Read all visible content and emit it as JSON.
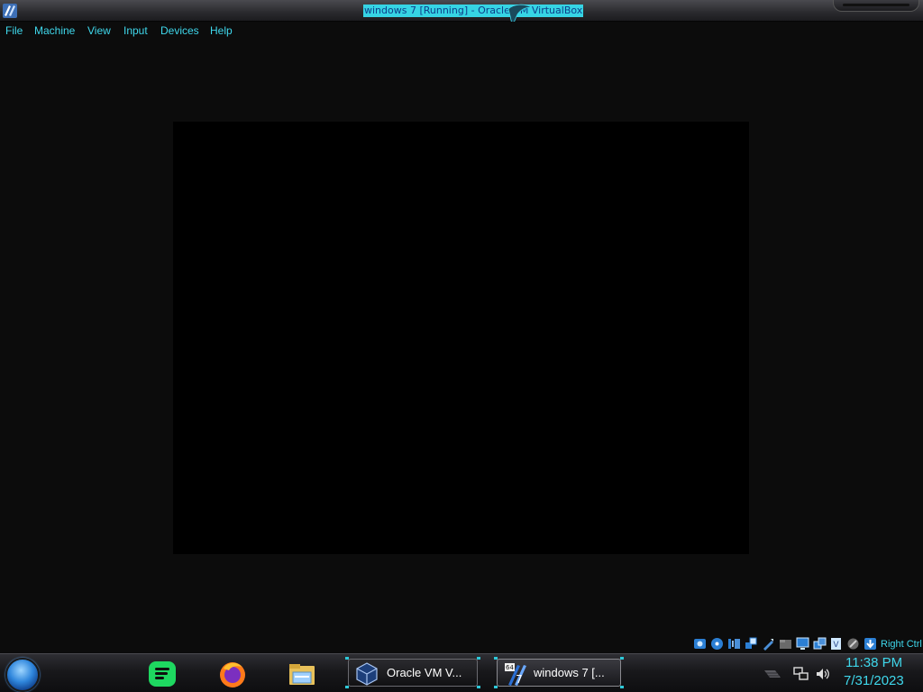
{
  "window": {
    "title": "windows 7 [Running] - Oracle VM VirtualBox",
    "app_icon": "virtualbox-icon"
  },
  "menubar": {
    "items": [
      "File",
      "Machine",
      "View",
      "Input",
      "Devices",
      "Help"
    ]
  },
  "statusbar": {
    "icons": [
      "hard-disk-icon",
      "optical-drive-icon",
      "audio-icon",
      "network-icon",
      "usb-icon",
      "shared-folders-icon",
      "display-icon",
      "video-capture-icon",
      "virtualization-icon",
      "mouse-integration-icon",
      "host-key-icon"
    ],
    "host_key_label": "Right Ctrl"
  },
  "taskbar": {
    "pinned": [
      "start-orb",
      "spotify-icon",
      "firefox-icon",
      "file-explorer-icon"
    ],
    "buttons": [
      {
        "label": "Oracle VM V...",
        "icon": "virtualbox-icon"
      },
      {
        "label": "windows 7 [...",
        "icon": "windows7-vm-icon"
      }
    ],
    "tray_icons": [
      "show-hidden-icon",
      "network-tray-icon",
      "volume-icon"
    ],
    "clock": {
      "time": "11:38 PM",
      "date": "7/31/2023"
    }
  },
  "colors": {
    "accent": "#3fd8ec",
    "background": "#0c0c0c",
    "vm_screen": "#000000"
  }
}
